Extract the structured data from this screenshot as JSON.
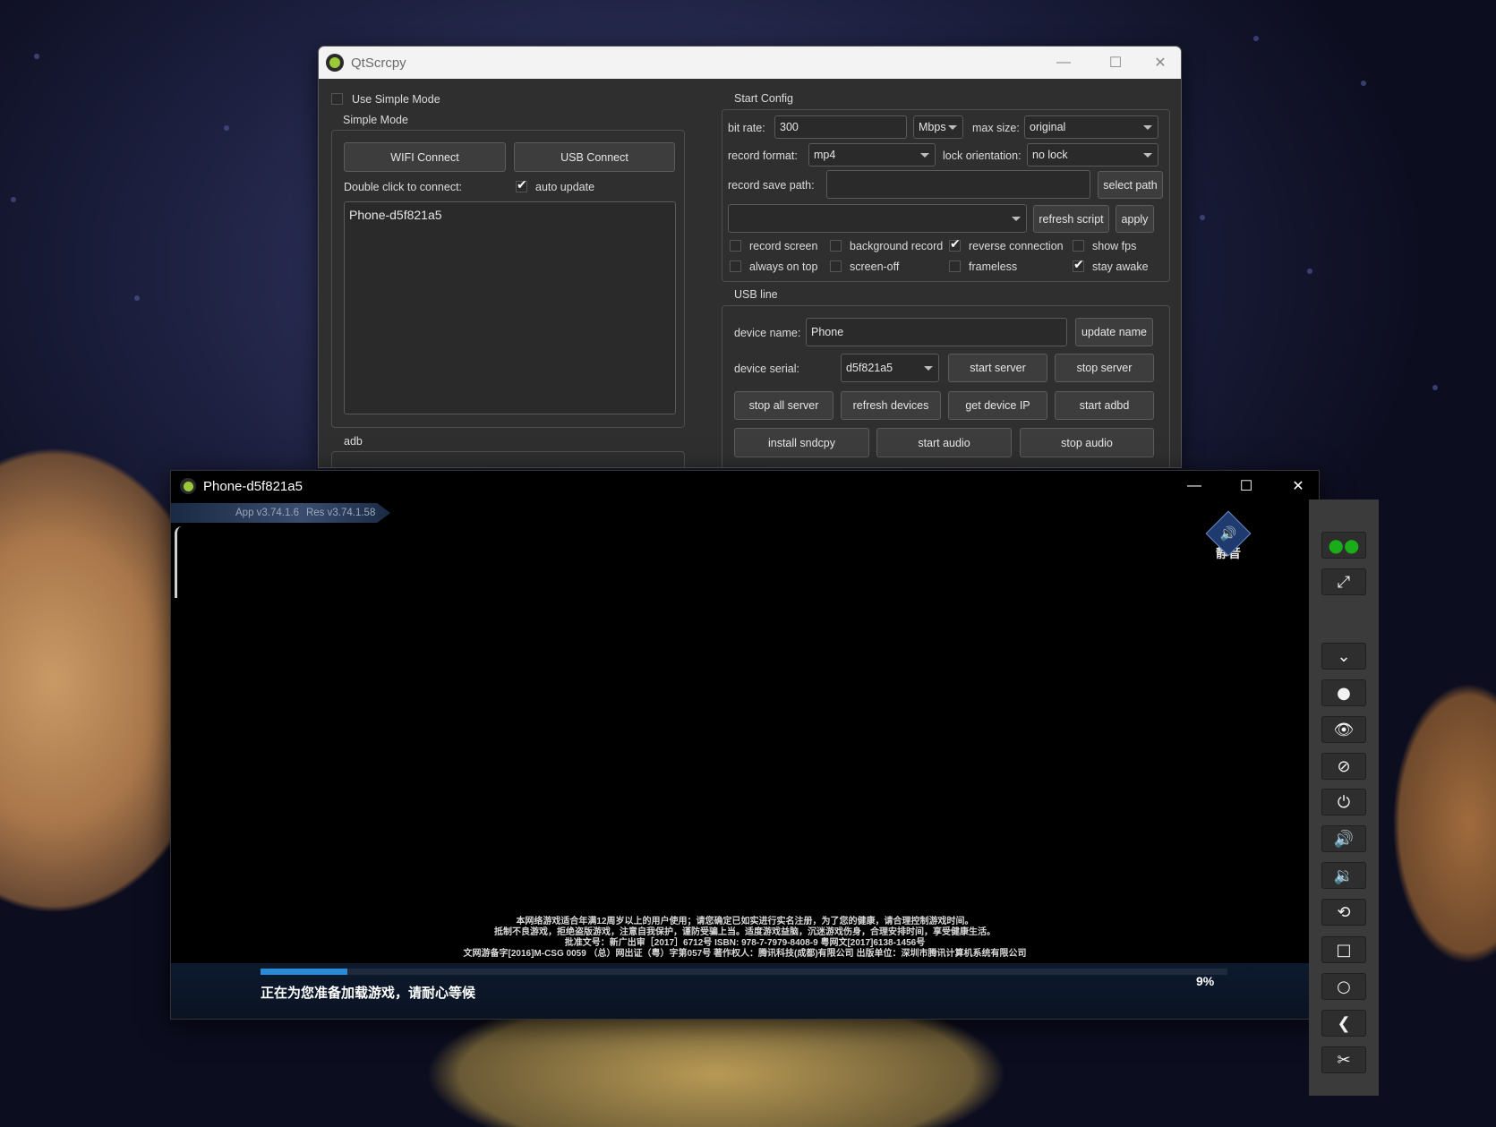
{
  "main_window": {
    "title": "QtScrcpy",
    "left": {
      "use_simple_mode": "Use Simple Mode",
      "simple_mode_group": "Simple Mode",
      "wifi_connect": "WIFI Connect",
      "usb_connect": "USB Connect",
      "double_click_hint": "Double click to connect:",
      "auto_update": "auto update",
      "devices": [
        "Phone-d5f821a5"
      ],
      "adb_group": "adb"
    },
    "start_config": {
      "group": "Start Config",
      "bit_rate_label": "bit rate:",
      "bit_rate_value": "300",
      "bit_rate_unit": "Mbps",
      "max_size_label": "max size:",
      "max_size_value": "original",
      "record_format_label": "record format:",
      "record_format_value": "mp4",
      "lock_orientation_label": "lock orientation:",
      "lock_orientation_value": "no lock",
      "record_save_path_label": "record save path:",
      "record_save_path_value": "",
      "select_path": "select path",
      "script_value": "",
      "refresh_script": "refresh script",
      "apply": "apply",
      "record_screen": "record screen",
      "background_record": "background record",
      "reverse_connection": "reverse connection",
      "show_fps": "show fps",
      "always_on_top": "always on top",
      "screen_off": "screen-off",
      "frameless": "frameless",
      "stay_awake": "stay awake"
    },
    "usb_line": {
      "group": "USB line",
      "device_name_label": "device name:",
      "device_name_value": "Phone",
      "update_name": "update name",
      "device_serial_label": "device serial:",
      "device_serial_value": "d5f821a5",
      "start_server": "start server",
      "stop_server": "stop server",
      "stop_all_server": "stop all server",
      "refresh_devices": "refresh devices",
      "get_device_ip": "get device IP",
      "start_adbd": "start adbd",
      "install_sndcpy": "install sndcpy",
      "start_audio": "start audio",
      "stop_audio": "stop audio"
    }
  },
  "phone_window": {
    "title": "Phone-d5f821a5",
    "app_version": "App v3.74.1.6",
    "res_version": "Res v3.74.1.58",
    "mute_label": "静音",
    "legal_lines": [
      "本网络游戏适合年满12周岁以上的用户使用；请您确定已如实进行实名注册，为了您的健康，请合理控制游戏时间。",
      "抵制不良游戏，拒绝盗版游戏，注意自我保护，谨防受骗上当。适度游戏益脑，沉迷游戏伤身，合理安排时间，享受健康生活。",
      "批准文号：新广出审［2017］6712号  ISBN: 978-7-7979-8408-9  粤网文[2017]6138-1456号",
      "文网游备字[2016]M-CSG 0059  （总）网出证（粤）字第057号  著作权人：腾讯科技(成都)有限公司  出版单位：深圳市腾讯计算机系统有限公司"
    ],
    "loading_text": "正在为您准备加载游戏，请耐心等候",
    "progress_percent": 9,
    "progress_label": "9%"
  },
  "toolbar_icons": [
    "wechat-icon",
    "fullscreen-icon",
    "expand-notification-icon",
    "touch-dot-icon",
    "show-icon",
    "hide-icon",
    "power-icon",
    "volume-up-icon",
    "volume-down-icon",
    "rotate-icon",
    "app-switch-icon",
    "home-icon",
    "back-icon",
    "screenshot-icon"
  ],
  "colors": {
    "window_bg": "#2f2f2f",
    "progress": "#2a8ad8",
    "wechat_green": "#1aad19"
  }
}
